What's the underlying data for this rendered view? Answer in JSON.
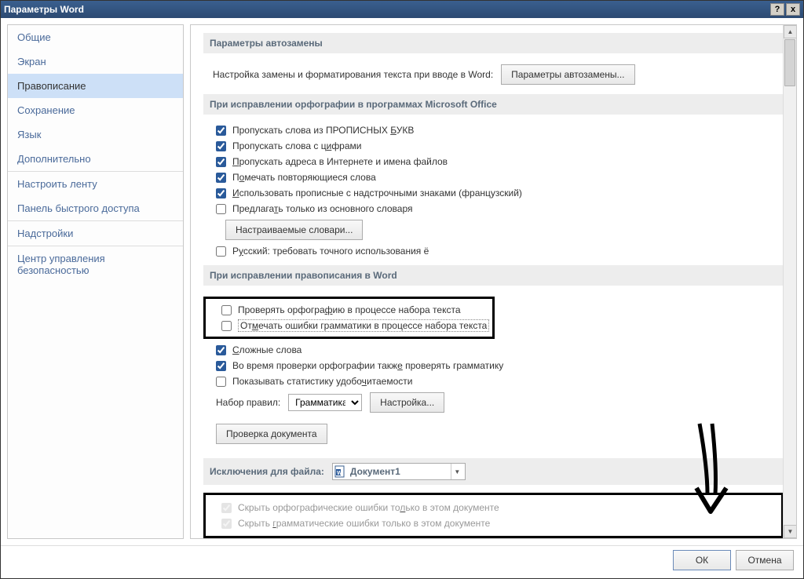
{
  "title": "Параметры Word",
  "titlebar": {
    "help": "?",
    "close": "x"
  },
  "sidebar": {
    "items": [
      {
        "label": "Общие"
      },
      {
        "label": "Экран"
      },
      {
        "label": "Правописание"
      },
      {
        "label": "Сохранение"
      },
      {
        "label": "Язык"
      },
      {
        "label": "Дополнительно"
      },
      {
        "label": "Настроить ленту"
      },
      {
        "label": "Панель быстрого доступа"
      },
      {
        "label": "Надстройки"
      },
      {
        "label": "Центр управления безопасностью"
      }
    ],
    "selected_index": 2
  },
  "content": {
    "section_autocorrect": "Параметры автозамены",
    "autocorrect_desc": "Настройка замены и форматирования текста при вводе в Word:",
    "autocorrect_btn": "Параметры автозамены...",
    "section_spelling": "При исправлении орфографии в программах Microsoft Office",
    "spelling_checks": [
      {
        "pre": "Пропускать слова из ПРОПИСНЫХ ",
        "u": "Б",
        "post": "УКВ",
        "checked": true
      },
      {
        "pre": "Пропускать слова с ц",
        "u": "и",
        "post": "фрами",
        "checked": true
      },
      {
        "pre": "",
        "u": "П",
        "post": "ропускать адреса в Интернете и имена файлов",
        "checked": true
      },
      {
        "pre": "П",
        "u": "о",
        "post": "мечать повторяющиеся слова",
        "checked": true
      },
      {
        "pre": "",
        "u": "И",
        "post": "спользовать прописные с надстрочными знаками (французский)",
        "checked": true
      },
      {
        "pre": "Предлага",
        "u": "т",
        "post": "ь только из основного словаря",
        "checked": false
      }
    ],
    "custom_dict_btn": "Настраиваемые словари...",
    "russian_yo": {
      "pre": "Р",
      "u": "у",
      "post": "сский: требовать точного использования ё",
      "checked": false
    },
    "section_word": "При исправлении правописания в Word",
    "word_checks_h1": [
      {
        "pre": "Проверять орфогра",
        "u": "ф",
        "post": "ию в процессе набора текста",
        "checked": false
      },
      {
        "pre": "От",
        "u": "м",
        "post": "ечать ошибки грамматики в процессе набора текста",
        "checked": false,
        "dotted": true
      }
    ],
    "word_checks_rest": [
      {
        "pre": "",
        "u": "С",
        "post": "ложные слова",
        "checked": true
      },
      {
        "pre": "Во время проверки орфографии такж",
        "u": "е",
        "post": " проверять грамматику",
        "checked": true
      },
      {
        "pre": "Показывать статистику удобо",
        "u": "ч",
        "post": "итаемости",
        "checked": false
      }
    ],
    "ruleset_label": "Набор правил:",
    "ruleset_value": "Грамматика",
    "settings_btn": "Настройка...",
    "check_doc_btn": "Проверка документа",
    "section_exceptions": "Исключения для файла:",
    "exceptions_file": "Документ1",
    "exceptions_checks": [
      {
        "pre": "Скрыть орфографические ошибки то",
        "u": "л",
        "post": "ько в этом документе",
        "checked": true
      },
      {
        "pre": "Скрыть ",
        "u": "г",
        "post": "рамматические ошибки только в этом документе",
        "checked": true
      }
    ]
  },
  "footer": {
    "ok": "ОК",
    "cancel": "Отмена"
  }
}
